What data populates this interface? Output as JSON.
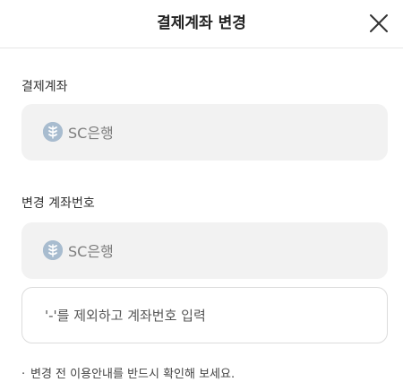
{
  "header": {
    "title": "결제계좌 변경"
  },
  "payment_account": {
    "label": "결제계좌",
    "bank_name": "SC은행",
    "bank_icon": "sc-bank-logo-icon"
  },
  "change_account": {
    "label": "변경 계좌번호",
    "bank_name": "SC은행",
    "bank_icon": "sc-bank-logo-icon",
    "account_input_placeholder": "'-'를 제외하고 계좌번호 입력",
    "account_input_value": ""
  },
  "notice": {
    "bullet": "·",
    "text": "변경 전 이용안내를 반드시 확인해 보세요."
  }
}
